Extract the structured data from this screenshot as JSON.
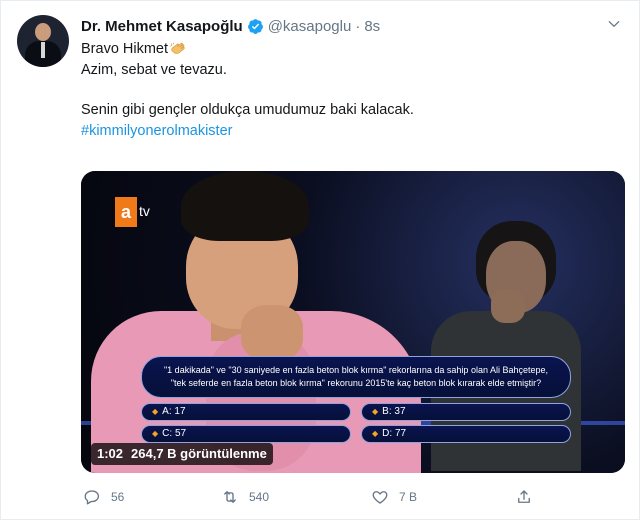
{
  "tweet": {
    "author_name": "Dr. Mehmet Kasapoğlu",
    "handle": "@kasapoglu",
    "separator": "·",
    "time": "8s",
    "line1": "Bravo Hikmet",
    "line2": "Azim, sebat ve tevazu.",
    "line3": "Senin gibi gençler oldukça umudumuz baki kalacak.",
    "hashtag": "#kimmilyonerolmakister"
  },
  "media": {
    "channel_logo": "a",
    "channel_suffix": "tv",
    "question_line1": "\"1 dakikada\" ve \"30 saniyede en fazla beton blok kırma\" rekorlarına da sahip olan Ali Bahçetepe,",
    "question_line2": "\"tek seferde en fazla beton blok kırma\" rekorunu 2015'te kaç beton blok kırarak elde etmiştir?",
    "options": [
      {
        "label": "A:",
        "value": "17"
      },
      {
        "label": "B:",
        "value": "37"
      },
      {
        "label": "C:",
        "value": "57"
      },
      {
        "label": "D:",
        "value": "77"
      }
    ],
    "duration": "1:02",
    "views": "264,7 B görüntülenme"
  },
  "actions": {
    "replies": "56",
    "retweets": "540",
    "likes": "7 B"
  },
  "colors": {
    "verified": "#1da1f2",
    "hashtag": "#1b95e0",
    "muted": "#657786"
  },
  "icons": {
    "verified": "verified-badge-icon",
    "clap": "clapping-hands-icon",
    "menu": "chevron-down-icon",
    "reply": "reply-icon",
    "retweet": "retweet-icon",
    "like": "heart-icon",
    "share": "share-icon"
  }
}
